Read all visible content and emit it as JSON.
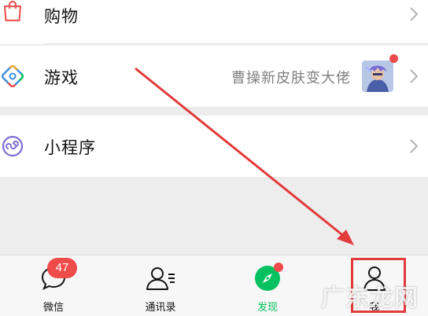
{
  "menu": {
    "shopping": {
      "label": "购物",
      "icon": "shopping-bag-icon"
    },
    "games": {
      "label": "游戏",
      "icon": "games-icon",
      "promo_text": "曹操新皮肤变大佬",
      "avatar": "game-character-avatar"
    },
    "mini_programs": {
      "label": "小程序",
      "icon": "mini-program-icon"
    }
  },
  "tabbar": {
    "chats": {
      "label": "微信",
      "badge": "47",
      "icon": "chat-bubble-icon"
    },
    "contacts": {
      "label": "通讯录",
      "icon": "contacts-icon"
    },
    "discover": {
      "label": "发现",
      "icon": "compass-icon",
      "active": true
    },
    "me": {
      "label": "我",
      "icon": "person-icon"
    }
  },
  "watermark": "广东龙网",
  "colors": {
    "accent_green": "#07c160",
    "badge_red": "#f04b4b",
    "highlight_red": "#e23b3b",
    "background": "#ededed"
  }
}
